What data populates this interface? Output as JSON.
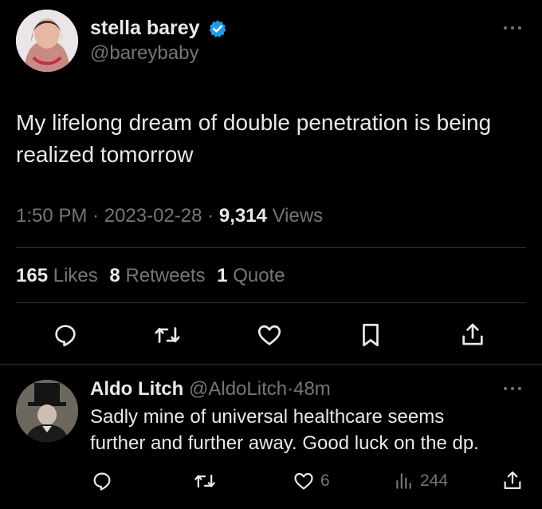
{
  "tweet": {
    "author_name": "stella barey",
    "author_handle": "@bareybaby",
    "text": "My lifelong dream of double penetration is being realized tomorrow",
    "time": "1:50 PM",
    "date": "2023-02-28",
    "views_count": "9,314",
    "views_label": "Views",
    "likes_count": "165",
    "likes_label": "Likes",
    "retweets_count": "8",
    "retweets_label": "Retweets",
    "quotes_count": "1",
    "quotes_label": "Quote",
    "sep": "·"
  },
  "reply": {
    "author_name": "Aldo Litch",
    "author_handle": "@AldoLitch",
    "time": "48m",
    "sep": "·",
    "text_line1": "Sadly mine of universal healthcare seems",
    "text_line2": "further and further away. Good luck on the dp.",
    "likes_count": "6",
    "views_count": "244"
  },
  "colors": {
    "background": "#000000",
    "text": "#e7e9ea",
    "muted": "#71767b",
    "verified": "#1d9bf0",
    "divider": "#2f3336"
  },
  "icons": [
    "more-icon",
    "verified-badge-icon",
    "reply-icon",
    "retweet-icon",
    "like-icon",
    "bookmark-icon",
    "share-icon",
    "views-icon"
  ]
}
